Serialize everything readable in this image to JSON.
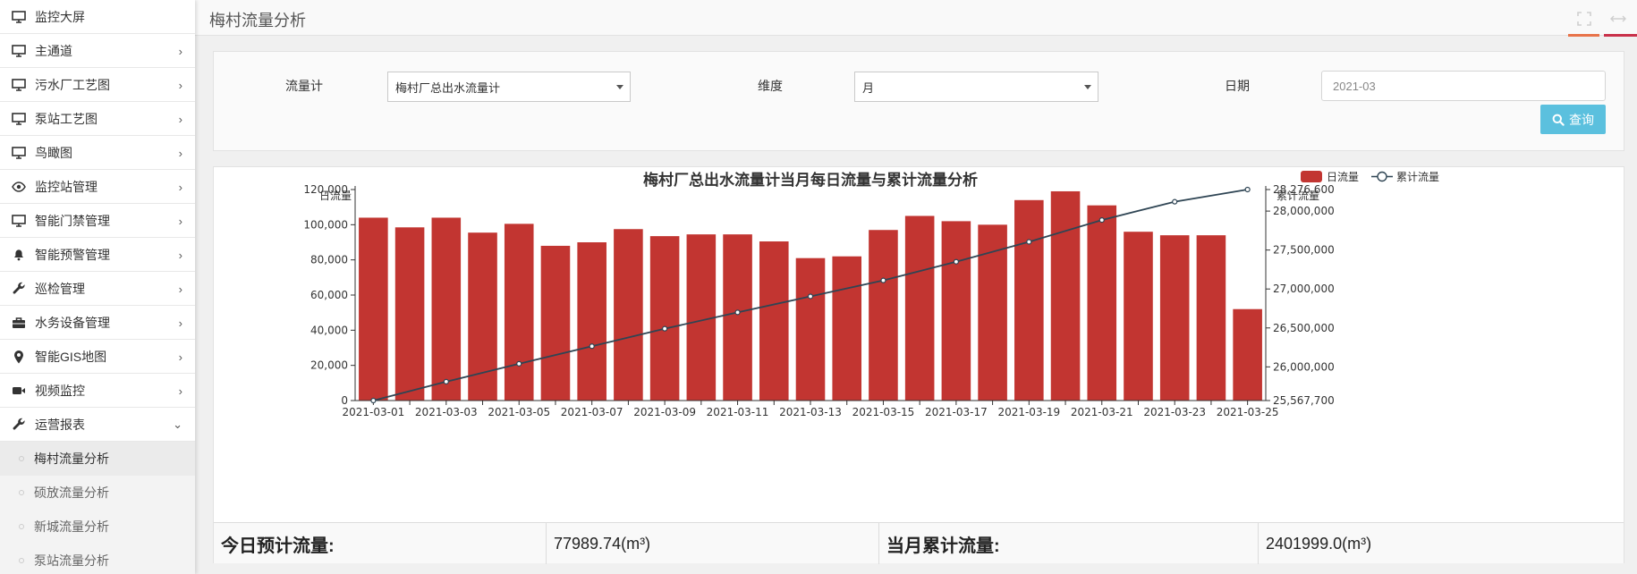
{
  "sidebar": {
    "items": [
      {
        "label": "监控大屏",
        "icon": "monitor-icon",
        "chev": ""
      },
      {
        "label": "主通道",
        "icon": "monitor-icon",
        "chev": "›"
      },
      {
        "label": "污水厂工艺图",
        "icon": "monitor-icon",
        "chev": "›"
      },
      {
        "label": "泵站工艺图",
        "icon": "monitor-icon",
        "chev": "›"
      },
      {
        "label": "鸟瞰图",
        "icon": "monitor-icon",
        "chev": "›"
      },
      {
        "label": "监控站管理",
        "icon": "eye-icon",
        "chev": "›"
      },
      {
        "label": "智能门禁管理",
        "icon": "monitor-icon",
        "chev": "›"
      },
      {
        "label": "智能预警管理",
        "icon": "bell-icon",
        "chev": "›"
      },
      {
        "label": "巡检管理",
        "icon": "wrench-icon",
        "chev": "›"
      },
      {
        "label": "水务设备管理",
        "icon": "briefcase-icon",
        "chev": "›"
      },
      {
        "label": "智能GIS地图",
        "icon": "map-pin-icon",
        "chev": "›"
      },
      {
        "label": "视频监控",
        "icon": "video-camera-icon",
        "chev": "›"
      },
      {
        "label": "运营报表",
        "icon": "wrench-icon",
        "chev": "⌄"
      }
    ],
    "sub_items": [
      {
        "label": "梅村流量分析",
        "active": true
      },
      {
        "label": "硕放流量分析",
        "active": false
      },
      {
        "label": "新城流量分析",
        "active": false
      },
      {
        "label": "泵站流量分析",
        "active": false
      }
    ]
  },
  "header": {
    "title": "梅村流量分析",
    "accent_colors": [
      "#e8734a",
      "#c9304a"
    ]
  },
  "filter": {
    "meter_label": "流量计",
    "meter_value": "梅村厂总出水流量计",
    "dimension_label": "维度",
    "dimension_value": "月",
    "date_label": "日期",
    "date_value": "2021-03",
    "query_label": "查询"
  },
  "chart_data": {
    "type": "bar",
    "title": "梅村厂总出水流量计当月每日流量与累计流量分析",
    "ylabel": "日流量",
    "y2label": "累计流量",
    "ylim": [
      0,
      120000
    ],
    "y2lim": [
      25567700,
      28276600
    ],
    "yticks": [
      "0",
      "20,000",
      "40,000",
      "60,000",
      "80,000",
      "100,000",
      "120,000"
    ],
    "y2ticks": [
      "25,567,700",
      "26,000,000",
      "26,500,000",
      "27,000,000",
      "27,500,000",
      "28,000,000",
      "28,276,600"
    ],
    "y2tick_values": [
      25567700,
      26000000,
      26500000,
      27000000,
      27500000,
      28000000,
      28276600
    ],
    "xticks": [
      "2021-03-01",
      "2021-03-03",
      "2021-03-05",
      "2021-03-07",
      "2021-03-09",
      "2021-03-11",
      "2021-03-13",
      "2021-03-15",
      "2021-03-17",
      "2021-03-19",
      "2021-03-21",
      "2021-03-23",
      "2021-03-25"
    ],
    "categories": [
      "2021-03-01",
      "2021-03-02",
      "2021-03-03",
      "2021-03-04",
      "2021-03-05",
      "2021-03-06",
      "2021-03-07",
      "2021-03-08",
      "2021-03-09",
      "2021-03-10",
      "2021-03-11",
      "2021-03-12",
      "2021-03-13",
      "2021-03-14",
      "2021-03-15",
      "2021-03-16",
      "2021-03-17",
      "2021-03-18",
      "2021-03-19",
      "2021-03-20",
      "2021-03-21",
      "2021-03-22",
      "2021-03-23",
      "2021-03-24",
      "2021-03-25"
    ],
    "series": [
      {
        "name": "日流量",
        "type": "bar",
        "color": "#c23531",
        "values": [
          104000,
          98500,
          104000,
          95500,
          100500,
          88000,
          90000,
          97500,
          93500,
          94500,
          94500,
          90500,
          81000,
          82000,
          97000,
          105000,
          102000,
          100000,
          114000,
          119000,
          111000,
          96000,
          94000,
          94000,
          52000
        ]
      },
      {
        "name": "累计流量",
        "type": "line",
        "color": "#2f4554",
        "values": [
          25567700,
          25810000,
          26040000,
          26265000,
          26490000,
          26700000,
          26905000,
          27110000,
          27350000,
          27605000,
          27885000,
          28120000,
          28276600
        ]
      }
    ],
    "legend": "top-right"
  },
  "summary": {
    "today_label": "今日预计流量:",
    "today_value": "77989.74(m³)",
    "month_label": "当月累计流量:",
    "month_value": "2401999.0(m³)"
  }
}
